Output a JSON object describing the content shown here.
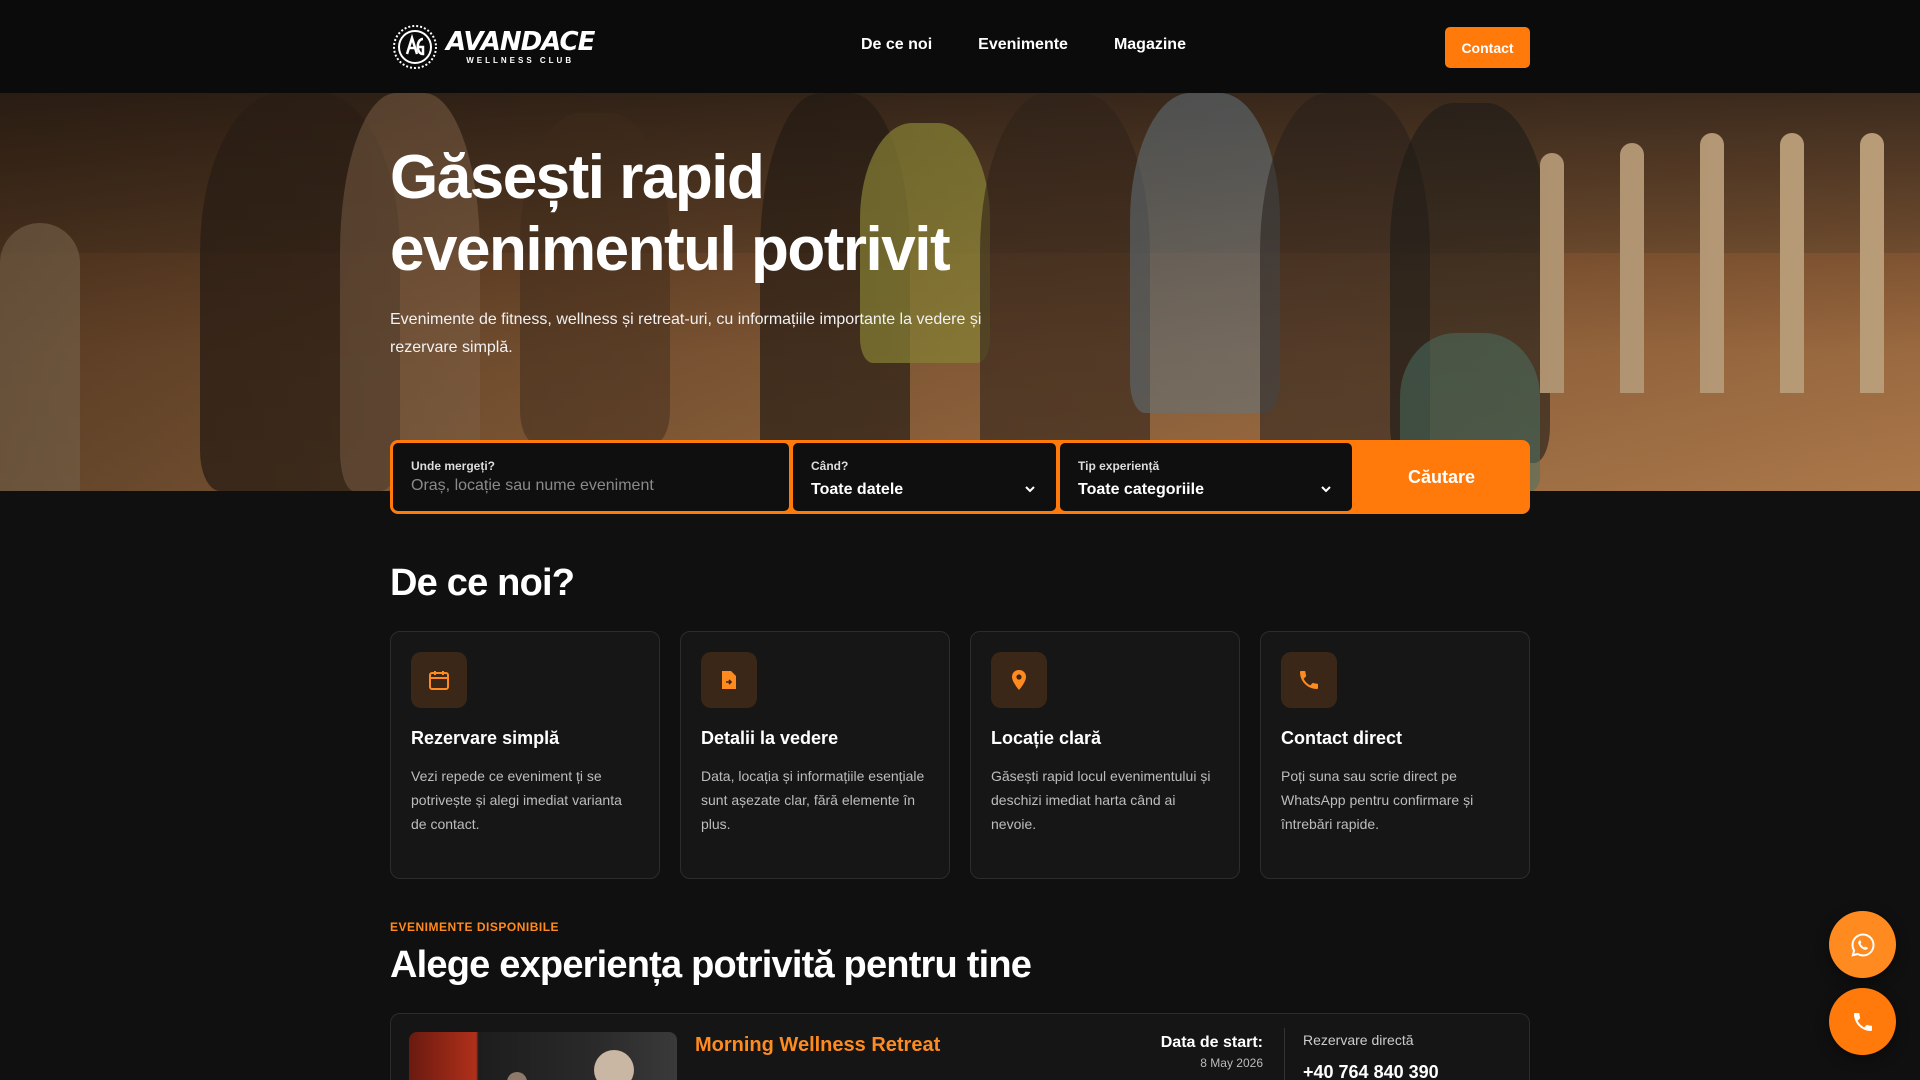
{
  "brand": {
    "logo_word": "AVANDACE",
    "logo_sub": "WELLNESS CLUB"
  },
  "nav": {
    "items": [
      {
        "label": "De ce noi"
      },
      {
        "label": "Evenimente"
      },
      {
        "label": "Magazine"
      }
    ],
    "contact_label": "Contact"
  },
  "hero": {
    "title_line1": "Găsești rapid",
    "title_line2": "evenimentul potrivit",
    "subtitle": "Evenimente de fitness, wellness și retreat-uri, cu informațiile importante la vedere și rezervare simplă."
  },
  "search": {
    "where_label": "Unde mergeți?",
    "where_placeholder": "Oraș, locație sau nume eveniment",
    "when_label": "Când?",
    "when_value": "Toate datele",
    "type_label": "Tip experiență",
    "type_value": "Toate categoriile",
    "button_label": "Căutare"
  },
  "why": {
    "title": "De ce noi?",
    "cards": [
      {
        "icon": "calendar-icon",
        "title": "Rezervare simplă",
        "text": "Vezi repede ce eveniment ți se potrivește și alegi imediat varianta de contact."
      },
      {
        "icon": "document-icon",
        "title": "Detalii la vedere",
        "text": "Data, locația și informațiile esențiale sunt așezate clar, fără elemente în plus."
      },
      {
        "icon": "map-pin-icon",
        "title": "Locație clară",
        "text": "Găsești rapid locul evenimentului și deschizi imediat harta când ai nevoie."
      },
      {
        "icon": "phone-icon",
        "title": "Contact direct",
        "text": "Poți suna sau scrie direct pe WhatsApp pentru confirmare și întrebări rapide."
      }
    ]
  },
  "events": {
    "eyebrow": "EVENIMENTE DISPONIBILE",
    "title": "Alege experiența potrivită pentru tine",
    "items": [
      {
        "title": "Morning Wellness Retreat",
        "date_label": "Data de start:",
        "date": "8 May 2026",
        "reservation_label": "Rezervare directă",
        "phone": "+40 764 840 390"
      }
    ]
  },
  "colors": {
    "accent": "#ff7a0a",
    "background": "#101010",
    "card": "#161616",
    "header": "#0b0b0b"
  },
  "floating": {
    "whatsapp_icon": "whatsapp-icon",
    "phone_icon": "phone-icon"
  }
}
